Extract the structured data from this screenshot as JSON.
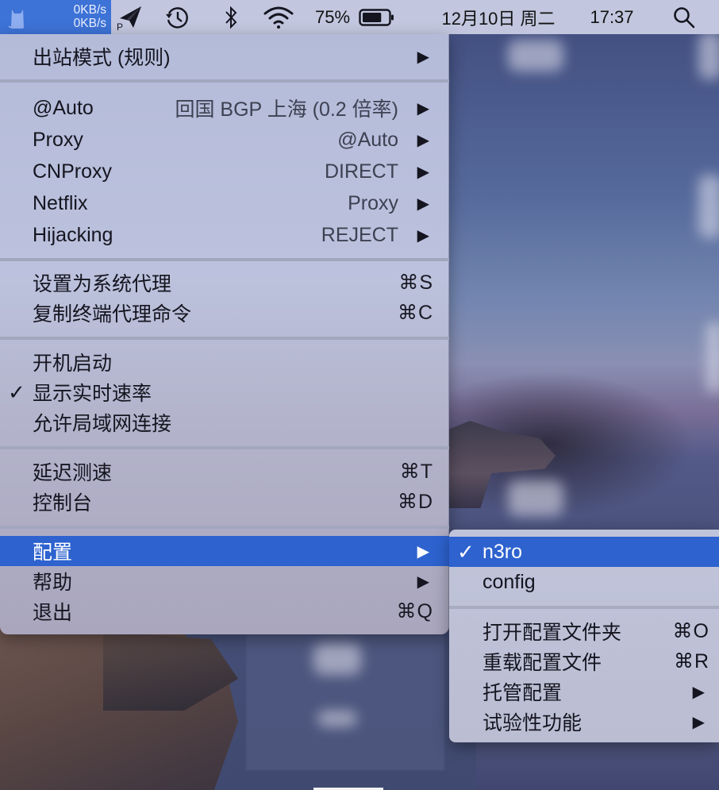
{
  "menubar": {
    "app": {
      "icon": "cat-icon",
      "upload_speed": "0KB/s",
      "download_speed": "0KB/s"
    },
    "status_icons": [
      {
        "name": "paper-plane-p-icon",
        "label": "P"
      },
      {
        "name": "time-machine-icon"
      },
      {
        "name": "bluetooth-icon"
      },
      {
        "name": "wifi-icon"
      }
    ],
    "battery_percent": "75%",
    "battery_level": 0.75,
    "date": "12月10日 周二",
    "time": "17:37",
    "search_icon": "search-icon"
  },
  "menu": {
    "outbound_mode": {
      "label": "出站模式 (规则)"
    },
    "proxy_groups": [
      {
        "label": "@Auto",
        "value": "回国 BGP 上海 (0.2 倍率)"
      },
      {
        "label": "Proxy",
        "value": "@Auto"
      },
      {
        "label": "CNProxy",
        "value": "DIRECT"
      },
      {
        "label": "Netflix",
        "value": "Proxy"
      },
      {
        "label": "Hijacking",
        "value": "REJECT"
      }
    ],
    "proxy_actions": [
      {
        "label": "设置为系统代理",
        "shortcut": "⌘S"
      },
      {
        "label": "复制终端代理命令",
        "shortcut": "⌘C"
      }
    ],
    "toggles": [
      {
        "label": "开机启动",
        "checked": false
      },
      {
        "label": "显示实时速率",
        "checked": true
      },
      {
        "label": "允许局域网连接",
        "checked": false
      }
    ],
    "tools": [
      {
        "label": "延迟测速",
        "shortcut": "⌘T"
      },
      {
        "label": "控制台",
        "shortcut": "⌘D"
      }
    ],
    "footer": [
      {
        "label": "配置",
        "has_submenu": true,
        "selected": true
      },
      {
        "label": "帮助",
        "has_submenu": true
      },
      {
        "label": "退出",
        "shortcut": "⌘Q"
      }
    ],
    "check_mark": "✓",
    "arrow": "▶"
  },
  "submenu": {
    "configs": [
      {
        "label": "n3ro",
        "checked": true,
        "selected": true
      },
      {
        "label": "config",
        "checked": false
      }
    ],
    "actions": [
      {
        "label": "打开配置文件夹",
        "shortcut": "⌘O"
      },
      {
        "label": "重载配置文件",
        "shortcut": "⌘R"
      },
      {
        "label": "托管配置",
        "has_submenu": true
      },
      {
        "label": "试验性功能",
        "has_submenu": true
      }
    ]
  }
}
